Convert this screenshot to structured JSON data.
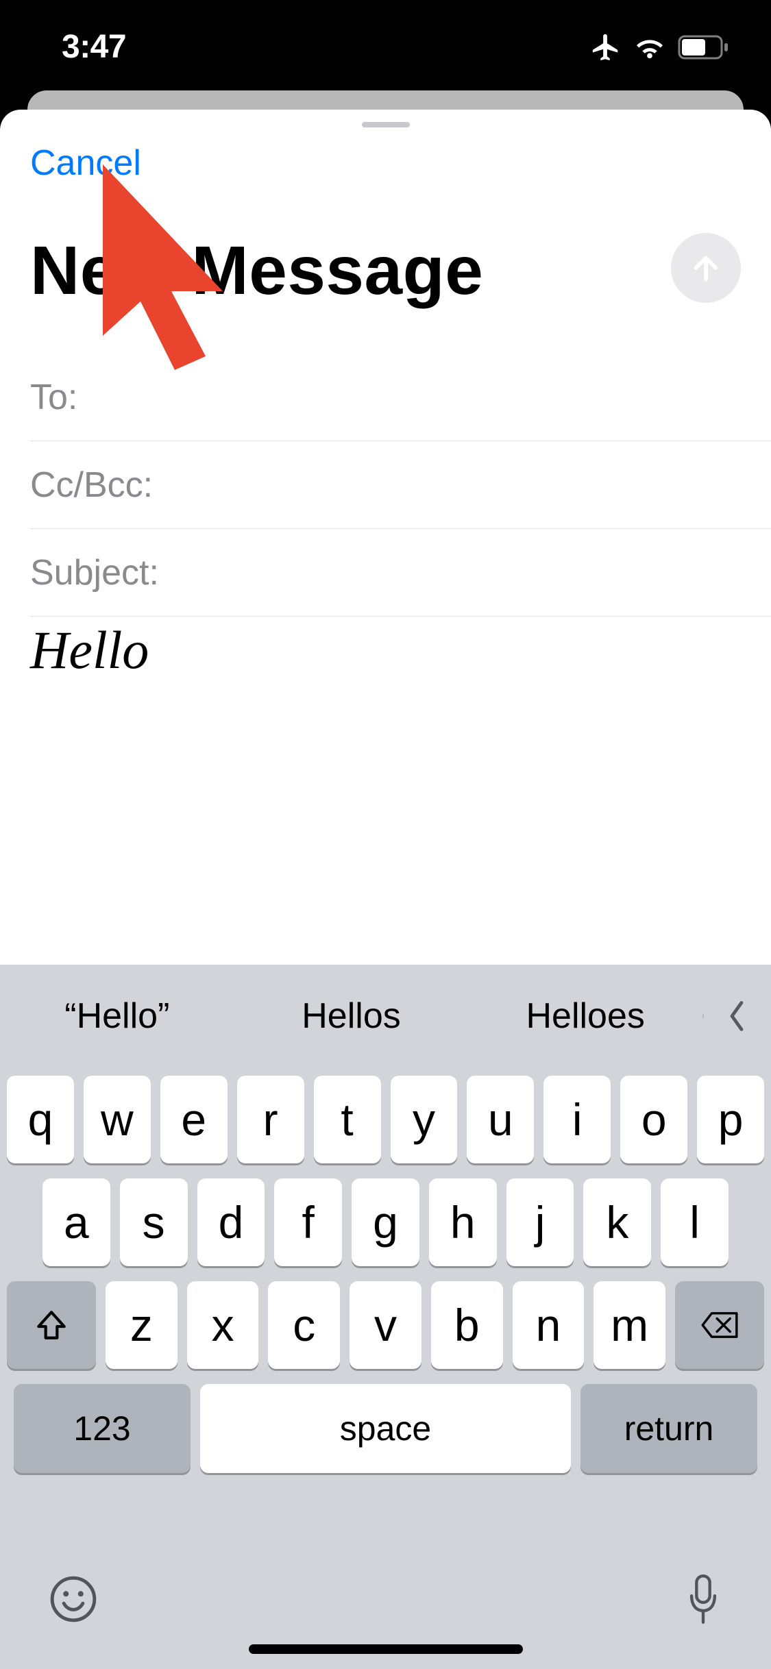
{
  "status": {
    "time": "3:47"
  },
  "sheet": {
    "cancel": "Cancel",
    "title": "New Message"
  },
  "fields": {
    "to": "To:",
    "ccbcc": "Cc/Bcc:",
    "subject": "Subject:"
  },
  "body": {
    "text": "Hello"
  },
  "keyboard": {
    "suggestions": [
      "“Hello”",
      "Hellos",
      "Helloes"
    ],
    "row1": [
      "q",
      "w",
      "e",
      "r",
      "t",
      "y",
      "u",
      "i",
      "o",
      "p"
    ],
    "row2": [
      "a",
      "s",
      "d",
      "f",
      "g",
      "h",
      "j",
      "k",
      "l"
    ],
    "row3": [
      "z",
      "x",
      "c",
      "v",
      "b",
      "n",
      "m"
    ],
    "modeKey": "123",
    "space": "space",
    "return": "return"
  }
}
